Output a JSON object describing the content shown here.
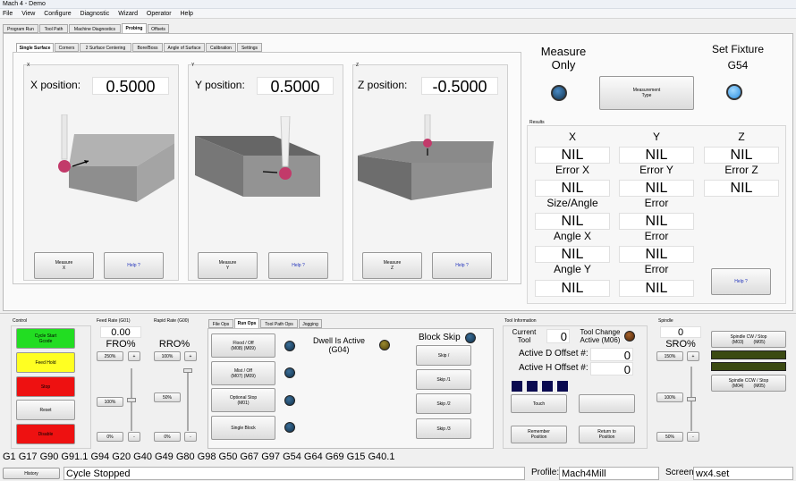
{
  "window": {
    "title": "Mach 4 - Demo"
  },
  "menu": [
    "File",
    "View",
    "Configure",
    "Diagnostic",
    "Wizard",
    "Operator",
    "Help"
  ],
  "main_tabs": [
    "Program Run",
    "Tool Path",
    "Machine Diagnostics",
    "Probing",
    "Offsets"
  ],
  "probing_tabs": [
    "Single Surface",
    "Corners",
    "2 Surface Centering",
    "Bore/Boss",
    "Angle of Surface",
    "Calibration",
    "Settings"
  ],
  "probes": [
    {
      "axis": "X",
      "label": "X position:",
      "value": "0.5000",
      "measure": "Measure\nX",
      "help": "Help ?"
    },
    {
      "axis": "Y",
      "label": "Y position:",
      "value": "0.5000",
      "measure": "Measure\nY",
      "help": "Help ?"
    },
    {
      "axis": "Z",
      "label": "Z position:",
      "value": "-0.5000",
      "measure": "Measure\nZ",
      "help": "Help ?"
    }
  ],
  "measure_only": {
    "line1": "Measure",
    "line2": "Only"
  },
  "set_fixture": {
    "label": "Set Fixture",
    "value": "G54"
  },
  "measurement_type_button": "Measurement\nType",
  "results": {
    "title": "Results",
    "col1": [
      {
        "label": "X",
        "value": "NIL"
      },
      {
        "label": "Error X",
        "value": "NIL"
      },
      {
        "label": "Size/Angle",
        "value": "NIL"
      },
      {
        "label": "Angle X",
        "value": "NIL"
      },
      {
        "label": "Angle Y",
        "value": "NIL"
      }
    ],
    "col2": [
      {
        "label": "Y",
        "value": "NIL"
      },
      {
        "label": "Error Y",
        "value": "NIL"
      },
      {
        "label": "Error",
        "value": "NIL"
      },
      {
        "label": "Error",
        "value": "NIL"
      },
      {
        "label": "Error",
        "value": "NIL"
      }
    ],
    "col3": [
      {
        "label": "Z",
        "value": "NIL"
      },
      {
        "label": "Error Z",
        "value": "NIL"
      }
    ],
    "help": "Help ?"
  },
  "control": {
    "title": "Control",
    "cycle_start": "Cycle Start\nGcode",
    "feed_hold": "Feed Hold",
    "stop": "Stop",
    "reset": "Reset",
    "disable": "Disable"
  },
  "feed_rate": {
    "title": "Feed Rate (G01)",
    "value": "0.00",
    "label": "FRO%",
    "btn250": "250%",
    "plus": "+",
    "btn100": "100%",
    "btn0": "0%",
    "minus": "-",
    "slider_fraction": 0.5
  },
  "rapid_rate": {
    "title": "Rapid Rate (G00)",
    "label": "RRO%",
    "btn100": "100%",
    "plus": "+",
    "btn50": "50%",
    "btn0": "0%",
    "minus": "-",
    "slider_fraction": 1.0
  },
  "ops_tabs": [
    "File Ops",
    "Run Ops",
    "Tool Path Ops",
    "Jogging"
  ],
  "run_ops": {
    "flood": "Flood / Off\n(M08) (M09)",
    "mist": "Mist / Off\n(M07) (M09)",
    "optional_stop": "Optional Stop\n(M01)",
    "single_block": "Single Block",
    "dwell": "Dwell Is Active\n(G04)",
    "block_skip": "Block Skip",
    "skip": [
      "Skip /",
      "Skip /1",
      "Skip /2",
      "Skip /3"
    ]
  },
  "tool_info": {
    "title": "Tool Information",
    "current_tool_label": "Current\nTool",
    "current_tool_value": "0",
    "tool_change_label": "Tool Change\nActive (M06)",
    "d_offset_label": "Active D Offset #:",
    "d_offset_value": "0",
    "h_offset_label": "Active H Offset #:",
    "h_offset_value": "0",
    "touch": "Touch",
    "remember": "Remember\nPosition",
    "return": "Return to\nPosition"
  },
  "spindle": {
    "title": "Spindle",
    "value": "0",
    "label": "SRO%",
    "btn150": "150%",
    "plus": "+",
    "btn100": "100%",
    "btn50": "50%",
    "minus": "-",
    "cw": "Spindle CW / Stop\n(M03)        (M05)",
    "ccw": "Spindle CCW / Stop\n(M04)        (M05)",
    "slider_fraction": 0.5
  },
  "gcode_line": "G1 G17 G90 G91.1 G94 G20 G40 G49 G80 G98 G50 G67 G97 G54 G64 G69 G15 G40.1",
  "status": {
    "history": "History",
    "message": "Cycle Stopped",
    "profile_label": "Profile:",
    "profile_value": "Mach4Mill",
    "screen_label": "Screen",
    "screen_value": "wx4.set"
  },
  "colors": {
    "green": "#22dd22",
    "yellow": "#ffff22",
    "red": "#ee1111",
    "led_blue": "#1e4f78",
    "led_blue_bright": "#2d8fe0",
    "led_olive": "#6a5a10",
    "led_brown": "#6b3a14",
    "spindle_bar": "#3b4a12"
  }
}
